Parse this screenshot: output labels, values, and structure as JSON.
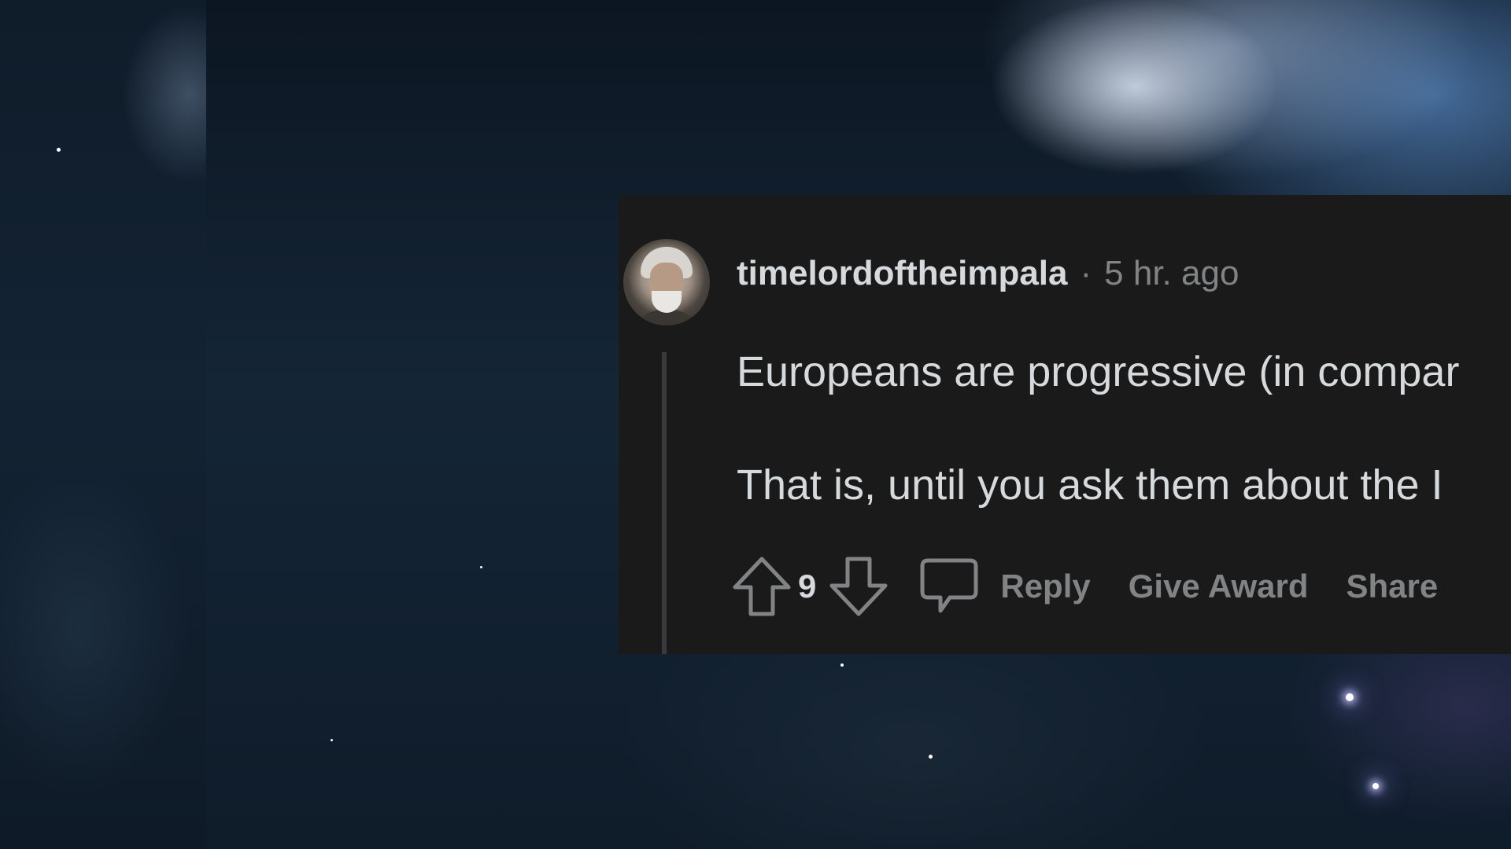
{
  "comment": {
    "username": "timelordoftheimpala",
    "separator": "·",
    "timestamp": "5 hr. ago",
    "paragraphs": [
      "Europeans are progressive (in compar",
      "That is, until you ask them about the I"
    ],
    "score": "9",
    "actions": {
      "reply": "Reply",
      "give_award": "Give Award",
      "share": "Share"
    }
  },
  "colors": {
    "card_background": "#1a1a1b",
    "primary_text": "#d7dadc",
    "secondary_text": "#818384"
  },
  "icons": [
    "upvote-arrow-icon",
    "downvote-arrow-icon",
    "comment-bubble-icon"
  ]
}
